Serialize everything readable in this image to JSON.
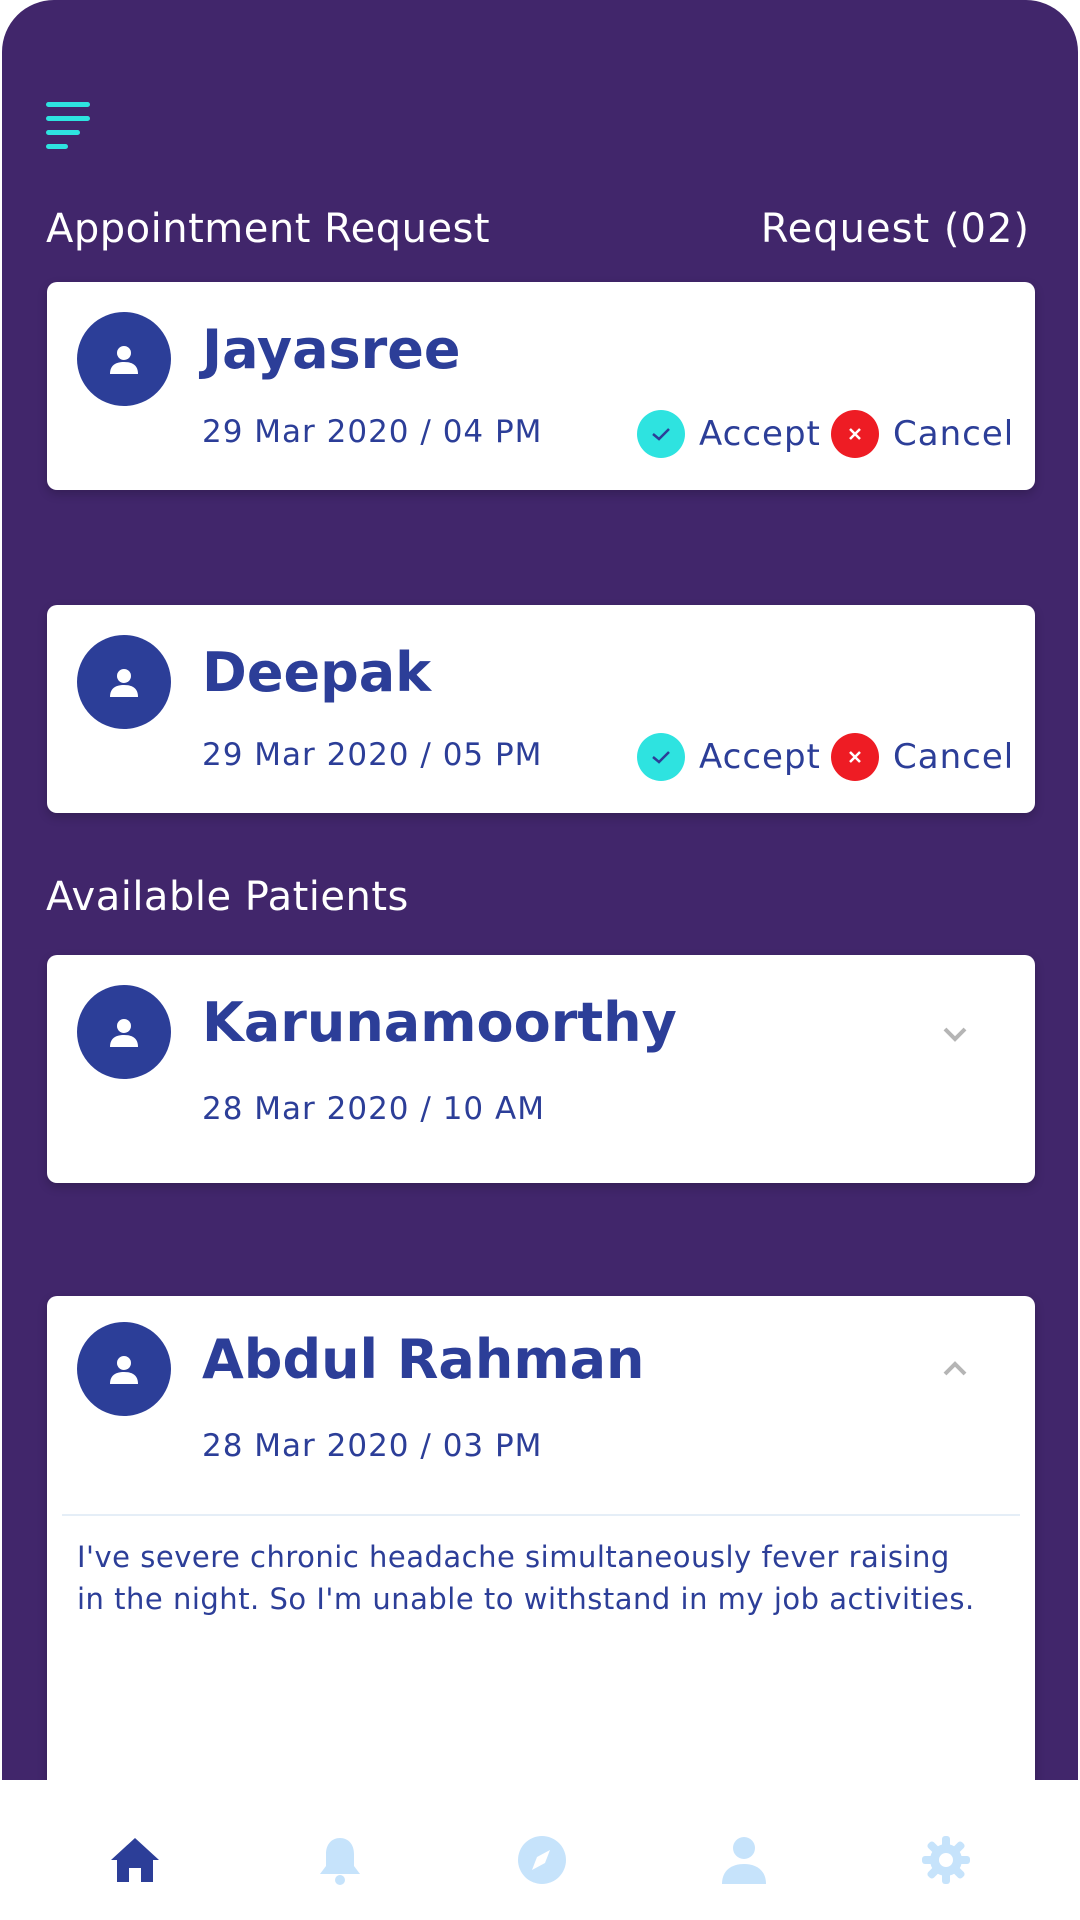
{
  "header": {
    "menu_icon": "hamburger-menu-icon"
  },
  "appointment_requests": {
    "title": "Appointment Request",
    "count_label": "Request  (02)",
    "items": [
      {
        "name": "Jayasree",
        "datetime": "29 Mar 2020 / 04 PM",
        "accept_label": "Accept",
        "cancel_label": "Cancel"
      },
      {
        "name": "Deepak",
        "datetime": "29 Mar 2020 / 05 PM",
        "accept_label": "Accept",
        "cancel_label": "Cancel"
      }
    ]
  },
  "available_patients": {
    "title": "Available Patients",
    "items": [
      {
        "name": "Karunamoorthy",
        "datetime": "28 Mar 2020 / 10 AM",
        "expanded": false
      },
      {
        "name": "Abdul Rahman",
        "datetime": "28 Mar 2020 / 03 PM",
        "expanded": true,
        "note": "I've severe chronic headache simultaneously fever raising in the night. So I'm unable to withstand in my job activities."
      }
    ]
  },
  "tabbar": {
    "items": [
      {
        "icon": "home-icon",
        "active": true
      },
      {
        "icon": "bell-icon",
        "active": false
      },
      {
        "icon": "compass-icon",
        "active": false
      },
      {
        "icon": "user-icon",
        "active": false
      },
      {
        "icon": "gear-icon",
        "active": false
      }
    ]
  },
  "colors": {
    "background": "#41266b",
    "accent_teal": "#2ee3e0",
    "primary_blue": "#2c3e98",
    "cancel_red": "#ee1c24",
    "inactive_tab": "#c6e3fb"
  }
}
